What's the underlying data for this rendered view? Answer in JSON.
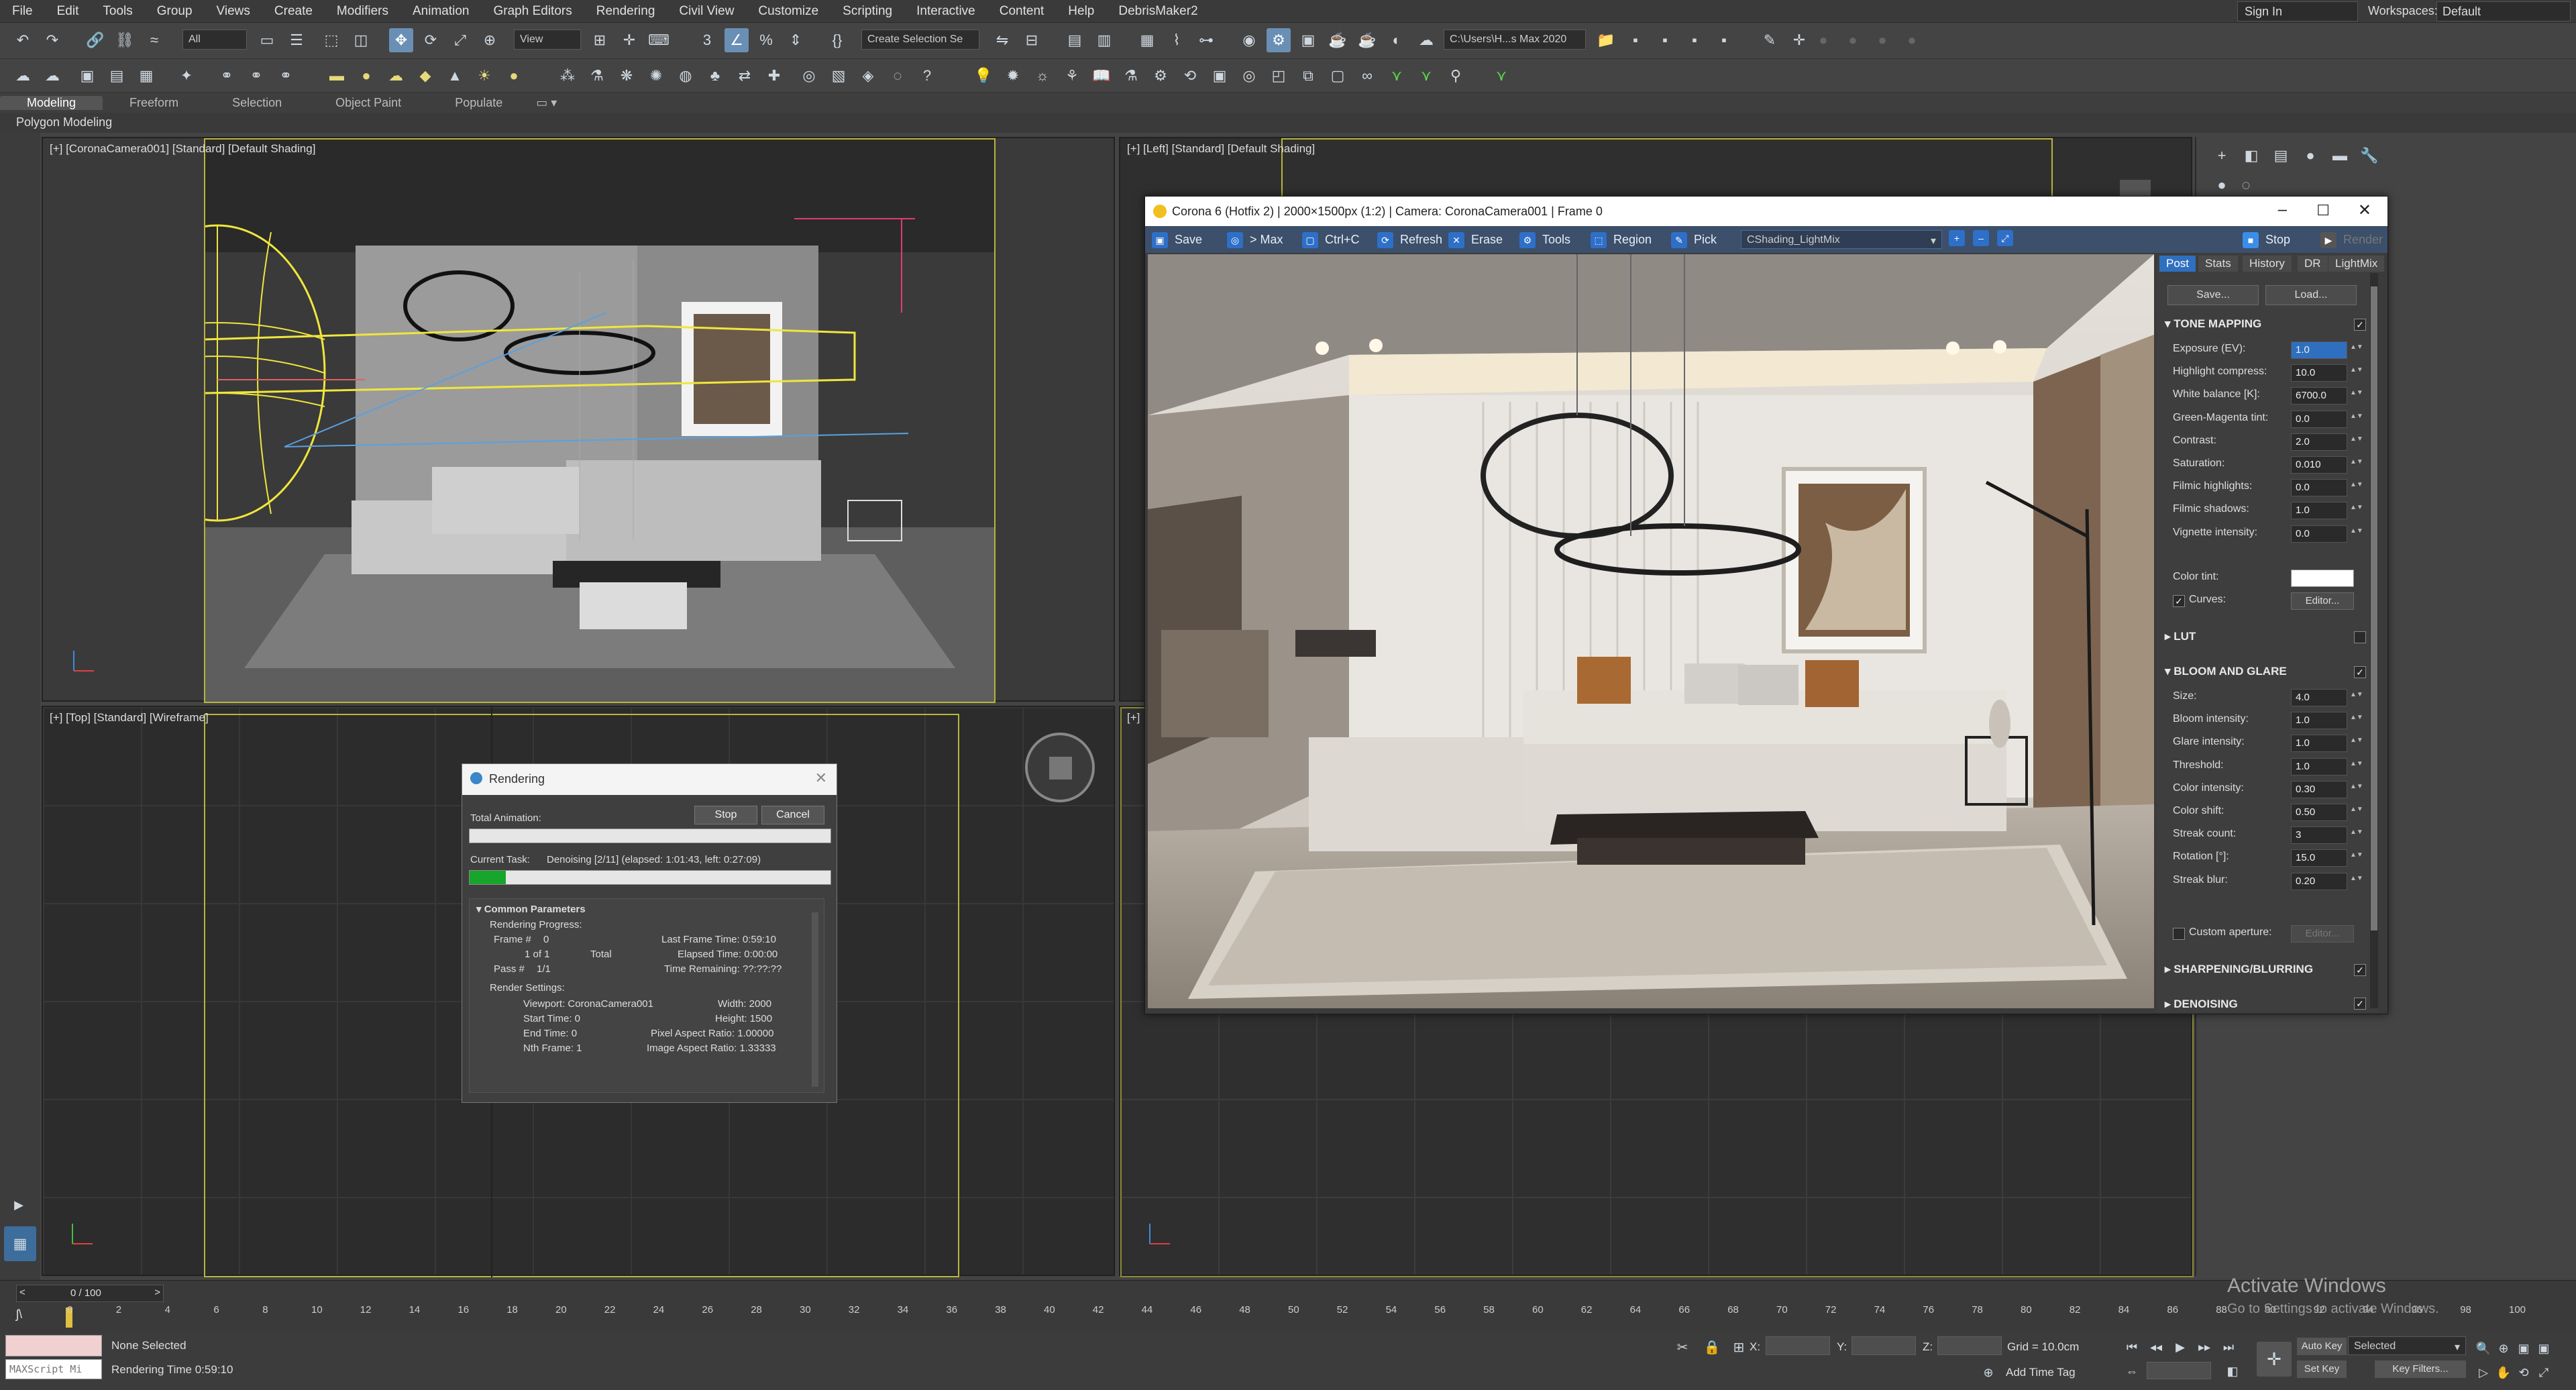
{
  "menu": [
    "File",
    "Edit",
    "Tools",
    "Group",
    "Views",
    "Create",
    "Modifiers",
    "Animation",
    "Graph Editors",
    "Rendering",
    "Civil View",
    "Customize",
    "Scripting",
    "Interactive",
    "Content",
    "Help",
    "DebrisMaker2"
  ],
  "signin": "Sign In",
  "workspaces_label": "Workspaces:",
  "workspaces_value": "Default",
  "toolbar": {
    "filter": "All",
    "refcoord": "View",
    "selection_set": "Create Selection Se",
    "project_path": "C:\\Users\\H...s Max 2020"
  },
  "ribbon_tabs": [
    "Modeling",
    "Freeform",
    "Selection",
    "Object Paint",
    "Populate"
  ],
  "polygon_modeling": "Polygon Modeling",
  "viewports": {
    "perspective": "[+] [CoronaCamera001] [Standard] [Default Shading]",
    "left": "[+] [Left] [Standard] [Default Shading]",
    "top": "[+] [Top] [Standard] [Wireframe]",
    "front": "[+]"
  },
  "rendering_dialog": {
    "title": "Rendering",
    "total_animation": "Total Animation:",
    "stop": "Stop",
    "cancel": "Cancel",
    "current_task_label": "Current Task:",
    "current_task": "Denoising [2/11] (elapsed: 1:01:43, left: 0:27:09)",
    "progress": 0.1,
    "common_parameters": "Common Parameters",
    "rendering_progress": "Rendering Progress:",
    "frame_label": "Frame #",
    "frame_val": "0",
    "of": "1 of 1",
    "total": "Total",
    "pass_label": "Pass #",
    "pass_val": "1/1",
    "last_frame_time": "Last Frame Time:  0:59:10",
    "elapsed_time": "Elapsed Time:  0:00:00",
    "time_remaining": "Time Remaining:  ??:??:??",
    "render_settings": "Render Settings:",
    "viewport": "Viewport:  CoronaCamera001",
    "width": "Width:  2000",
    "start_time": "Start Time:  0",
    "height": "Height:  1500",
    "end_time": "End Time:  0",
    "pixel_aspect": "Pixel Aspect Ratio:  1.00000",
    "nth_frame": "Nth Frame:  1",
    "image_aspect": "Image Aspect Ratio:  1.33333"
  },
  "vfb": {
    "title": "Corona 6 (Hotfix 2) | 2000×1500px (1:2) | Camera: CoronaCamera001 | Frame 0",
    "tools": [
      "Save",
      "> Max",
      "Ctrl+C",
      "Refresh",
      "Erase",
      "Tools",
      "Region",
      "Pick"
    ],
    "lightmix": "CShading_LightMix",
    "stop": "Stop",
    "render": "Render",
    "tabs": [
      "Post",
      "Stats",
      "History",
      "DR",
      "LightMix"
    ],
    "save": "Save...",
    "load": "Load...",
    "tone_mapping": "TONE MAPPING",
    "tm_params": [
      {
        "label": "Exposure (EV):",
        "value": "1.0"
      },
      {
        "label": "Highlight compress:",
        "value": "10.0"
      },
      {
        "label": "White balance [K]:",
        "value": "6700.0"
      },
      {
        "label": "Green-Magenta tint:",
        "value": "0.0"
      },
      {
        "label": "Contrast:",
        "value": "2.0"
      },
      {
        "label": "Saturation:",
        "value": "0.010"
      },
      {
        "label": "Filmic highlights:",
        "value": "0.0"
      },
      {
        "label": "Filmic shadows:",
        "value": "1.0"
      },
      {
        "label": "Vignette intensity:",
        "value": "0.0"
      }
    ],
    "color_tint": "Color tint:",
    "curves": "Curves:",
    "editor": "Editor...",
    "lut": "LUT",
    "bloom": "BLOOM AND GLARE",
    "bg_params": [
      {
        "label": "Size:",
        "value": "4.0"
      },
      {
        "label": "Bloom intensity:",
        "value": "1.0"
      },
      {
        "label": "Glare intensity:",
        "value": "1.0"
      },
      {
        "label": "Threshold:",
        "value": "1.0"
      },
      {
        "label": "Color intensity:",
        "value": "0.30"
      },
      {
        "label": "Color shift:",
        "value": "0.50"
      },
      {
        "label": "Streak count:",
        "value": "3"
      },
      {
        "label": "Rotation [°]:",
        "value": "15.0"
      },
      {
        "label": "Streak blur:",
        "value": "0.20"
      }
    ],
    "custom_aperture": "Custom aperture:",
    "sharpening": "SHARPENING/BLURRING",
    "denoising": "DENOISING"
  },
  "timeline": {
    "frame": "0 / 100",
    "ticks": [
      "0",
      "2",
      "4",
      "6",
      "8",
      "10",
      "12",
      "14",
      "16",
      "18",
      "20",
      "22",
      "24",
      "26",
      "28",
      "30",
      "32",
      "34",
      "36",
      "38",
      "40",
      "42",
      "44",
      "46",
      "48",
      "50",
      "52",
      "54",
      "56",
      "58",
      "60",
      "62",
      "64",
      "66",
      "68",
      "70",
      "72",
      "74",
      "76",
      "78",
      "80",
      "82",
      "84",
      "86",
      "88",
      "90",
      "92",
      "94",
      "96",
      "98",
      "100"
    ]
  },
  "status": {
    "maxscript": "MAXScript Mi",
    "none_selected": "None Selected",
    "rendering_time": "Rendering Time  0:59:10",
    "x": "X:",
    "y": "Y:",
    "z": "Z:",
    "grid": "Grid = 10.0cm",
    "add_time_tag": "Add Time Tag",
    "auto_key": "Auto Key",
    "selected": "Selected",
    "set_key": "Set Key",
    "key_filters": "Key Filters..."
  },
  "activate": "Activate Windows",
  "activate_sub": "Go to Settings to activate Windows."
}
